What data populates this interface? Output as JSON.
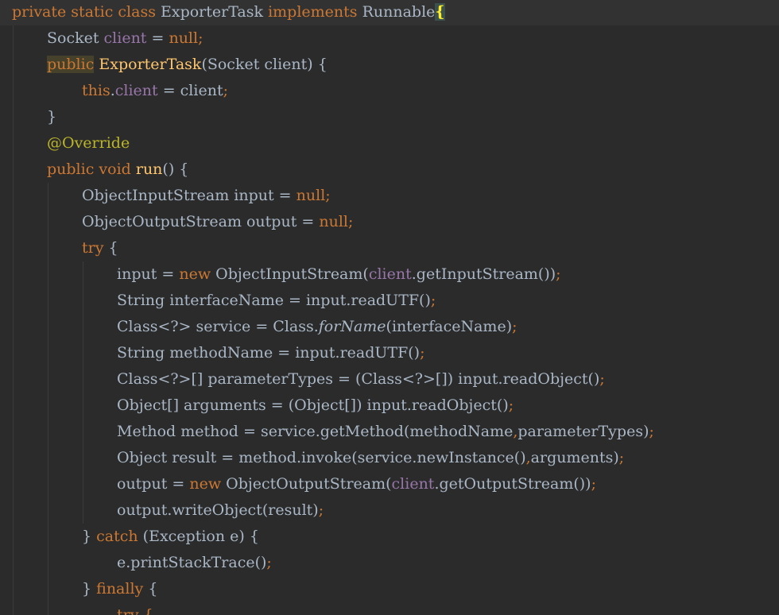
{
  "editor": {
    "language": "java",
    "colors": {
      "background": "#2b2b2b",
      "current_line": "#323232",
      "keyword": "#cc7832",
      "method_decl": "#ffc66d",
      "field": "#9876aa",
      "annotation": "#bbb529",
      "text": "#a9b7c6"
    },
    "lines": [
      {
        "indent": 0,
        "current": true,
        "tokens": [
          {
            "t": "private static class ",
            "c": "kw"
          },
          {
            "t": "ExporterTask ",
            "c": "txt"
          },
          {
            "t": "implements ",
            "c": "kw"
          },
          {
            "t": "Runnable",
            "c": "txt"
          },
          {
            "t": "{",
            "c": "brace-match"
          }
        ]
      },
      {
        "indent": 1,
        "tokens": [
          {
            "t": "Socket ",
            "c": "txt"
          },
          {
            "t": "client ",
            "c": "fld"
          },
          {
            "t": "= ",
            "c": "txt"
          },
          {
            "t": "null",
            "c": "kw"
          },
          {
            "t": ";",
            "c": "semi"
          }
        ]
      },
      {
        "indent": 1,
        "tokens": [
          {
            "t": "public",
            "c": "kw hl-usage"
          },
          {
            "t": " ",
            "c": "txt"
          },
          {
            "t": "ExporterTask",
            "c": "fn"
          },
          {
            "t": "(Socket client) {",
            "c": "txt"
          }
        ]
      },
      {
        "indent": 2,
        "tokens": [
          {
            "t": "this",
            "c": "kw"
          },
          {
            "t": ".",
            "c": "txt"
          },
          {
            "t": "client ",
            "c": "fld"
          },
          {
            "t": "= client",
            "c": "txt"
          },
          {
            "t": ";",
            "c": "semi"
          }
        ]
      },
      {
        "indent": 1,
        "tokens": [
          {
            "t": "}",
            "c": "txt"
          }
        ]
      },
      {
        "indent": 1,
        "tokens": [
          {
            "t": "@Override",
            "c": "ann"
          }
        ]
      },
      {
        "indent": 1,
        "tokens": [
          {
            "t": "public void ",
            "c": "kw"
          },
          {
            "t": "run",
            "c": "fn"
          },
          {
            "t": "() {",
            "c": "txt"
          }
        ]
      },
      {
        "indent": 2,
        "tokens": [
          {
            "t": "ObjectInputStream input = ",
            "c": "txt"
          },
          {
            "t": "null",
            "c": "kw"
          },
          {
            "t": ";",
            "c": "semi"
          }
        ]
      },
      {
        "indent": 2,
        "tokens": [
          {
            "t": "ObjectOutputStream output = ",
            "c": "txt"
          },
          {
            "t": "null",
            "c": "kw"
          },
          {
            "t": ";",
            "c": "semi"
          }
        ]
      },
      {
        "indent": 2,
        "tokens": [
          {
            "t": "try ",
            "c": "kw"
          },
          {
            "t": "{",
            "c": "txt"
          }
        ]
      },
      {
        "indent": 3,
        "tokens": [
          {
            "t": "input = ",
            "c": "txt"
          },
          {
            "t": "new ",
            "c": "kw"
          },
          {
            "t": "ObjectInputStream(",
            "c": "txt"
          },
          {
            "t": "client",
            "c": "fld"
          },
          {
            "t": ".getInputStream())",
            "c": "txt"
          },
          {
            "t": ";",
            "c": "semi"
          }
        ]
      },
      {
        "indent": 3,
        "tokens": [
          {
            "t": "String interfaceName = input.readUTF()",
            "c": "txt"
          },
          {
            "t": ";",
            "c": "semi"
          }
        ]
      },
      {
        "indent": 3,
        "tokens": [
          {
            "t": "Class<?> service = Class.",
            "c": "txt"
          },
          {
            "t": "forName",
            "c": "st"
          },
          {
            "t": "(interfaceName)",
            "c": "txt"
          },
          {
            "t": ";",
            "c": "semi"
          }
        ]
      },
      {
        "indent": 3,
        "tokens": [
          {
            "t": "String methodName = input.readUTF()",
            "c": "txt"
          },
          {
            "t": ";",
            "c": "semi"
          }
        ]
      },
      {
        "indent": 3,
        "tokens": [
          {
            "t": "Class<?>[] parameterTypes = (Class<?>[]) input.readObject()",
            "c": "txt"
          },
          {
            "t": ";",
            "c": "semi"
          }
        ]
      },
      {
        "indent": 3,
        "tokens": [
          {
            "t": "Object[] arguments = (Object[]) input.readObject()",
            "c": "txt"
          },
          {
            "t": ";",
            "c": "semi"
          }
        ]
      },
      {
        "indent": 3,
        "tokens": [
          {
            "t": "Method method = service.getMethod(methodName",
            "c": "txt"
          },
          {
            "t": ",",
            "c": "semi"
          },
          {
            "t": "parameterTypes)",
            "c": "txt"
          },
          {
            "t": ";",
            "c": "semi"
          }
        ]
      },
      {
        "indent": 3,
        "tokens": [
          {
            "t": "Object result = method.invoke(service.newInstance()",
            "c": "txt"
          },
          {
            "t": ",",
            "c": "semi"
          },
          {
            "t": "arguments)",
            "c": "txt"
          },
          {
            "t": ";",
            "c": "semi"
          }
        ]
      },
      {
        "indent": 3,
        "tokens": [
          {
            "t": "output = ",
            "c": "txt"
          },
          {
            "t": "new ",
            "c": "kw"
          },
          {
            "t": "ObjectOutputStream(",
            "c": "txt"
          },
          {
            "t": "client",
            "c": "fld"
          },
          {
            "t": ".getOutputStream())",
            "c": "txt"
          },
          {
            "t": ";",
            "c": "semi"
          }
        ]
      },
      {
        "indent": 3,
        "tokens": [
          {
            "t": "output.writeObject(result)",
            "c": "txt"
          },
          {
            "t": ";",
            "c": "semi"
          }
        ]
      },
      {
        "indent": 2,
        "tokens": [
          {
            "t": "} ",
            "c": "txt"
          },
          {
            "t": "catch ",
            "c": "kw"
          },
          {
            "t": "(Exception e) {",
            "c": "txt"
          }
        ]
      },
      {
        "indent": 3,
        "tokens": [
          {
            "t": "e.printStackTrace()",
            "c": "txt"
          },
          {
            "t": ";",
            "c": "semi"
          }
        ]
      },
      {
        "indent": 2,
        "tokens": [
          {
            "t": "} ",
            "c": "txt"
          },
          {
            "t": "finally ",
            "c": "kw"
          },
          {
            "t": "{",
            "c": "txt"
          }
        ]
      },
      {
        "indent": 3,
        "tokens": [
          {
            "t": "try {",
            "c": "kw"
          }
        ]
      }
    ]
  }
}
